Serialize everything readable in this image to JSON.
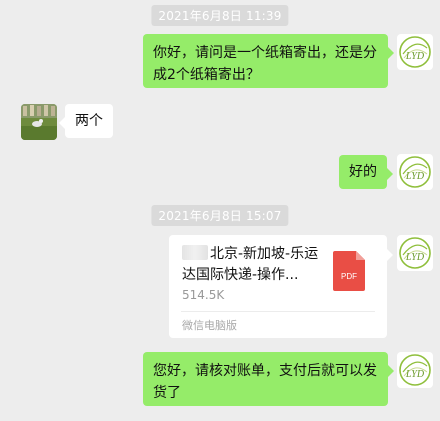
{
  "timestamps": [
    "2021年6月8日 11:39",
    "2021年6月8日 15:07"
  ],
  "messages": [
    {
      "from": "me",
      "text": "你好，请问是一个纸箱寄出，还是分成2个纸箱寄出？"
    },
    {
      "from": "them",
      "text": "两个"
    },
    {
      "from": "me",
      "text": "好的"
    },
    {
      "from": "me",
      "type": "file",
      "file_name": "北京-新加坡-乐运达国际快递-操作...",
      "file_size": "514.5K",
      "file_icon_label": "PDF",
      "file_source": "微信电脑版"
    },
    {
      "from": "me",
      "text": "您好，请核对账单，支付后就可以发货了"
    }
  ],
  "avatar": {
    "logo_text": "LYD"
  },
  "colors": {
    "background": "#ededed",
    "self_bubble": "#95ec69",
    "other_bubble": "#ffffff",
    "timestamp_bg": "#dadada",
    "pdf_red": "#e94e45",
    "logo_green": "#8fbf3c"
  }
}
